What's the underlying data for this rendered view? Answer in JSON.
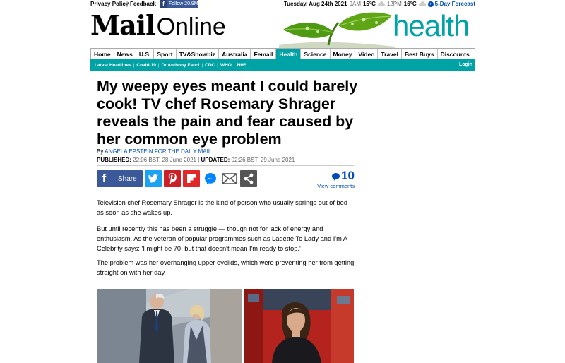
{
  "topbar": {
    "privacy_policy": "Privacy Policy",
    "feedback": "Feedback",
    "follow_label": "Follow 20.9M",
    "date": "Tuesday, Aug 24th 2021",
    "time1": "9AM",
    "temp1": "15°C",
    "time2": "12PM",
    "temp2": "16°C",
    "forecast": "5-Day Forecast"
  },
  "masthead": {
    "logo_mail": "Mail",
    "logo_online": "Online",
    "section_title": "health"
  },
  "nav": {
    "items": [
      "Home",
      "News",
      "U.S.",
      "Sport",
      "TV&Showbiz",
      "Australia",
      "Femail",
      "Health",
      "Science",
      "Money",
      "Video",
      "Travel",
      "Best Buys",
      "Discounts"
    ],
    "active": "Health"
  },
  "subnav": {
    "items": [
      "Latest Headlines",
      "Covid-19",
      "Dr Anthony Fauci",
      "CDC",
      "WHO",
      "NHS"
    ],
    "login": "Login"
  },
  "article": {
    "headline": "My weepy eyes meant I could barely cook! TV chef Rosemary Shrager reveals the pain and fear caused by her common eye problem",
    "by_prefix": "By",
    "author": "ANGELA EPSTEIN FOR THE DAILY MAIL",
    "published_label": "PUBLISHED:",
    "published": "22:06 BST, 28 June 2021",
    "updated_label": "UPDATED:",
    "updated": "02:26 BST, 29 June 2021",
    "share_label": "Share",
    "comment_count": "10",
    "view_comments": "View comments",
    "paragraphs": [
      "Television chef Rosemary Shrager is the kind of person who usually springs out of bed as soon as she wakes up.",
      "But until recently this has been a struggle — though not for lack of energy and enthusiasm. As the veteran of popular programmes such as Ladette To Lady and I'm A Celebrity says: 'I might be 70, but that doesn't mean I'm ready to stop.'",
      "The problem was her overhanging upper eyelids, which were preventing her from getting straight on with her day."
    ]
  },
  "colors": {
    "accent": "#00a3a5",
    "link": "#004db3",
    "facebook": "#3b5998",
    "twitter": "#1da1f2",
    "pinterest": "#cb2027",
    "flipboard": "#e12828"
  }
}
